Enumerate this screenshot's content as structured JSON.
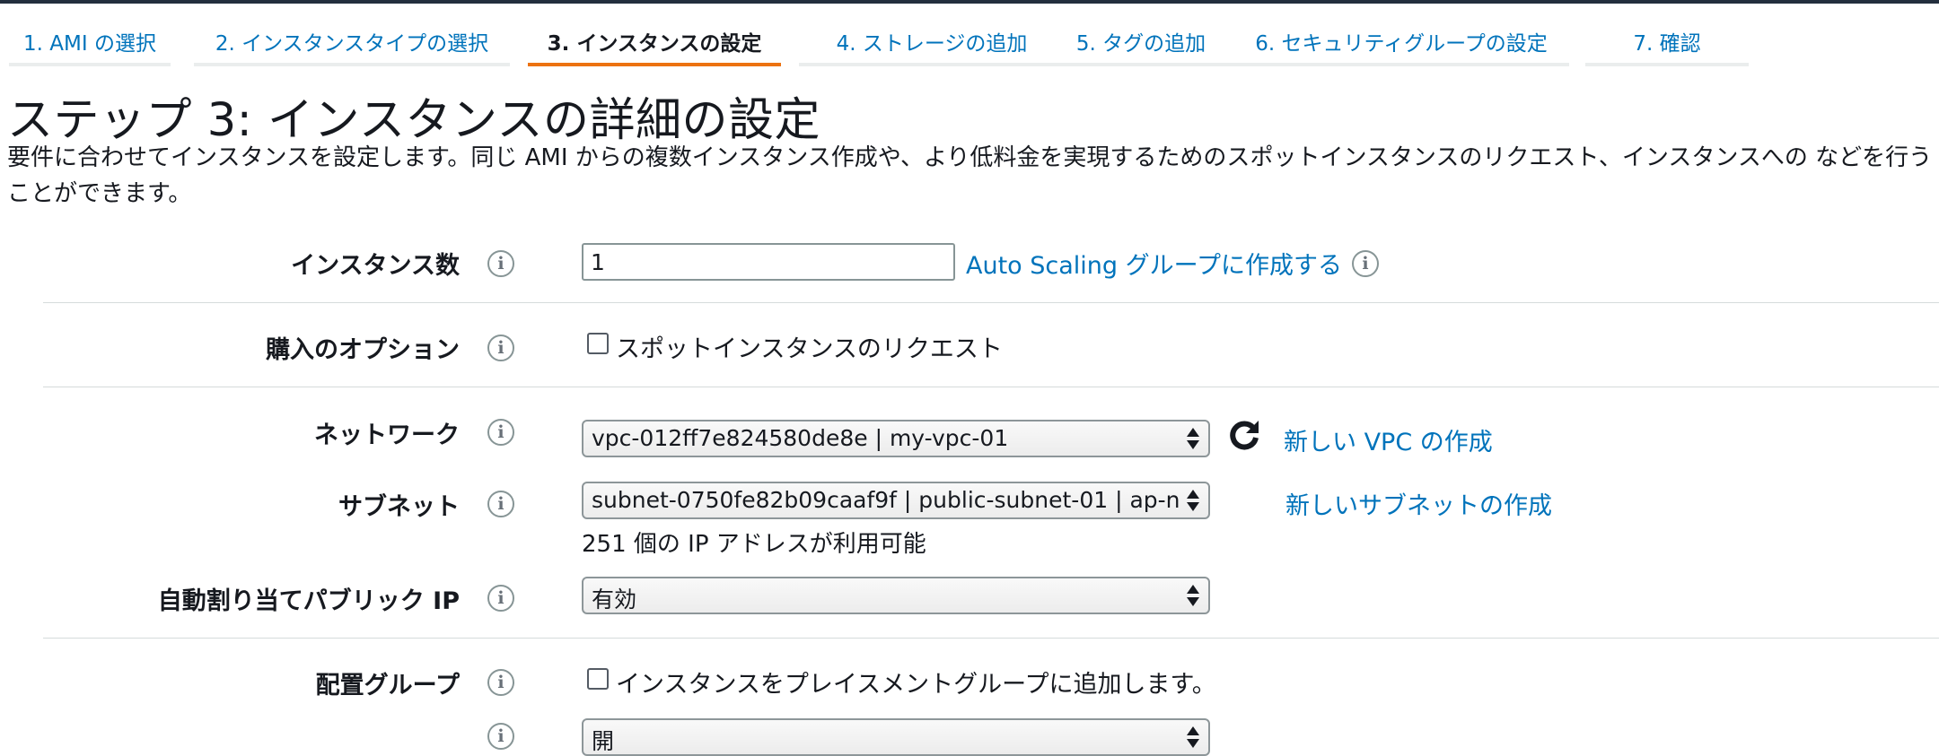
{
  "tabs": [
    {
      "label": "1. AMI の選択"
    },
    {
      "label": "2. インスタンスタイプの選択"
    },
    {
      "label": "3. インスタンスの設定"
    },
    {
      "label": "4. ストレージの追加"
    },
    {
      "label": "5. タグの追加"
    },
    {
      "label": "6. セキュリティグループの設定"
    },
    {
      "label": "7. 確認"
    }
  ],
  "active_tab": "3. インスタンスの設定",
  "page": {
    "title": "ステップ 3: インスタンスの詳細の設定",
    "description": "要件に合わせてインスタンスを設定します。同じ AMI からの複数インスタンス作成や、より低料金を実現するためのスポットインスタンスのリクエスト、インスタンスへの などを行うことができます。"
  },
  "form": {
    "instance_count": {
      "label": "インスタンス数",
      "value": "1",
      "link": "Auto Scaling グループに作成する"
    },
    "purchase_option": {
      "label": "購入のオプション",
      "checkbox_label": "スポットインスタンスのリクエスト",
      "checked": false
    },
    "network": {
      "label": "ネットワーク",
      "selected": "vpc-012ff7e824580de8e | my-vpc-01",
      "link": "新しい VPC の作成"
    },
    "subnet": {
      "label": "サブネット",
      "selected": "subnet-0750fe82b09caaf9f | public-subnet-01 | ap-n",
      "helper": "251 個の IP アドレスが利用可能",
      "link": "新しいサブネットの作成"
    },
    "auto_assign_ip": {
      "label": "自動割り当てパブリック IP",
      "selected": "有効"
    },
    "placement_group": {
      "label": "配置グループ",
      "checkbox_label": "インスタンスをプレイスメントグループに追加します。",
      "checked": false
    },
    "next_field": {
      "selected": "開"
    }
  },
  "icons": {
    "info": "info-icon",
    "refresh": "refresh-icon",
    "select_arrows": "select-arrows-icon"
  },
  "colors": {
    "link": "#0073bb",
    "active_tab_underline": "#ec7211",
    "top_bar": "#232f3e"
  }
}
